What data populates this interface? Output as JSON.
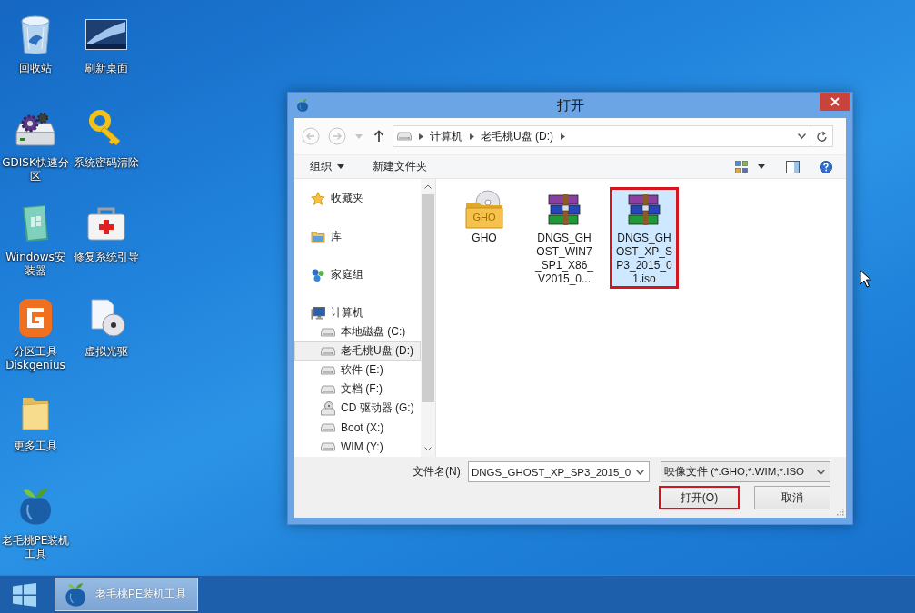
{
  "desktop_icons": [
    {
      "label": "回收站",
      "kind": "recycle-bin"
    },
    {
      "label": "GDISK快速分区",
      "kind": "disk-tool"
    },
    {
      "label": "Windows安装器",
      "kind": "installer"
    },
    {
      "label": "分区工具 Diskgenius",
      "kind": "partition-tool"
    },
    {
      "label": "更多工具",
      "kind": "folder"
    },
    {
      "label": "老毛桃PE装机工具",
      "kind": "peach"
    },
    {
      "label": "刷新桌面",
      "kind": "screen"
    },
    {
      "label": "系统密码清除",
      "kind": "key"
    },
    {
      "label": "修复系统引导",
      "kind": "repair-kit"
    },
    {
      "label": "虚拟光驱",
      "kind": "virtual-drive"
    }
  ],
  "dialog": {
    "title": "打开",
    "history": [
      {
        "kind": "back",
        "disabled": true
      },
      {
        "kind": "forward",
        "disabled": true
      },
      {
        "kind": "recent",
        "disabled": true
      },
      {
        "kind": "up",
        "disabled": false
      }
    ],
    "address": {
      "segments": [
        "计算机",
        "老毛桃U盘 (D:)"
      ]
    },
    "toolbar": [
      {
        "label": "组织",
        "kind": "menu"
      },
      {
        "label": "新建文件夹",
        "kind": "command"
      }
    ],
    "nav": [
      {
        "label": "收藏夹",
        "kind": "favorites",
        "selected": false
      },
      {
        "label": "库",
        "kind": "libraries",
        "selected": false
      },
      {
        "label": "家庭组",
        "kind": "homegroup",
        "selected": false
      },
      {
        "label": "计算机",
        "kind": "computer",
        "selected": false,
        "children": [
          {
            "label": "本地磁盘 (C:)",
            "kind": "drive",
            "selected": false
          },
          {
            "label": "老毛桃U盘 (D:)",
            "kind": "drive",
            "selected": true
          },
          {
            "label": "软件 (E:)",
            "kind": "drive",
            "selected": false
          },
          {
            "label": "文档 (F:)",
            "kind": "drive",
            "selected": false
          },
          {
            "label": "CD 驱动器 (G:)",
            "kind": "cd-drive",
            "selected": false
          },
          {
            "label": "Boot (X:)",
            "kind": "drive",
            "selected": false
          },
          {
            "label": "WIM (Y:)",
            "kind": "drive",
            "selected": false
          }
        ]
      }
    ],
    "files": [
      {
        "name": "GHO",
        "kind": "folder",
        "icon_text": "GHO",
        "selected": false,
        "highlighted": false
      },
      {
        "name": "DNGS_GHOST_WIN7_SP1_X86_V2015_0...",
        "kind": "archive",
        "selected": false,
        "highlighted": false
      },
      {
        "name": "DNGS_GHOST_XP_SP3_2015_01.iso",
        "kind": "archive",
        "selected": true,
        "highlighted": true
      }
    ],
    "filename": {
      "label": "文件名(N):",
      "value": "DNGS_GHOST_XP_SP3_2015_0"
    },
    "filter": {
      "value": "映像文件 (*.GHO;*.WIM;*.ISO"
    },
    "buttons": [
      {
        "label": "打开(O)",
        "highlighted": true
      },
      {
        "label": "取消",
        "highlighted": false
      }
    ]
  },
  "taskbar": {
    "tasks": [
      {
        "label": "老毛桃PE装机工具",
        "kind": "peach",
        "active": true
      }
    ]
  }
}
